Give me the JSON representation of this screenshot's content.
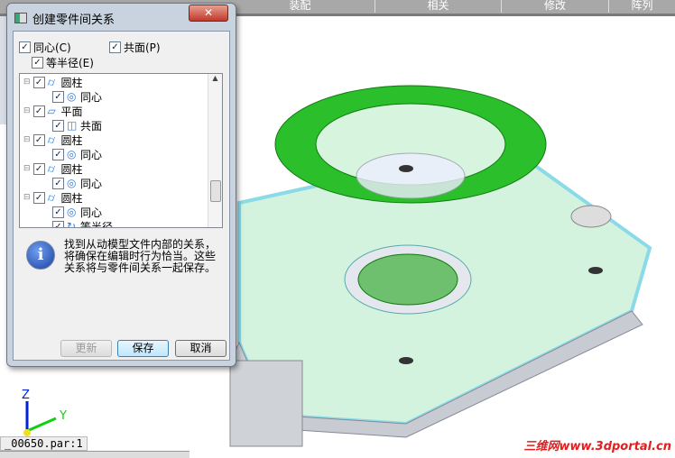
{
  "toolbar": {
    "tabs": [
      "装配",
      "相关",
      "修改",
      "阵列"
    ]
  },
  "dialog": {
    "title": "创建零件间关系",
    "close_label": "✕",
    "options": {
      "concentric": "同心(C)",
      "coplanar": "共面(P)",
      "equal_radius": "等半径(E)"
    },
    "tree": [
      {
        "label": "圆柱",
        "kind": "cylinder",
        "child": "同心",
        "child_kind": "concentric"
      },
      {
        "label": "平面",
        "kind": "plane",
        "child": "共面",
        "child_kind": "coplanar"
      },
      {
        "label": "圆柱",
        "kind": "cylinder",
        "child": "同心",
        "child_kind": "concentric"
      },
      {
        "label": "圆柱",
        "kind": "cylinder",
        "child": "同心",
        "child_kind": "concentric"
      },
      {
        "label": "圆柱",
        "kind": "cylinder",
        "child": "同心",
        "child_kind": "concentric",
        "child2": "等半径"
      }
    ],
    "info": "找到从动模型文件内部的关系，将确保在编辑时行为恰当。这些关系将与零件间关系一起保存。",
    "buttons": {
      "update": "更新",
      "save": "保存",
      "cancel": "取消"
    }
  },
  "viewport": {
    "axis_z": "Z",
    "axis_y": "Y",
    "filename": "_00650.par:1"
  },
  "watermark": "三维网www.3dportal.cn",
  "colors": {
    "model_green": "#1fae1f",
    "model_face": "#c8f0d8",
    "edge_cyan": "#7fd6e6"
  }
}
